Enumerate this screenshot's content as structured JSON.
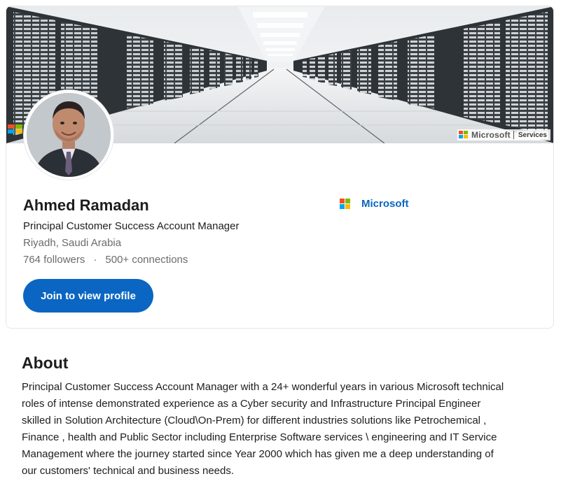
{
  "profile": {
    "name": "Ahmed Ramadan",
    "headline": "Principal Customer Success Account Manager",
    "location": "Riyadh, Saudi Arabia",
    "followers": "764 followers",
    "separator": "·",
    "connections": "500+ connections",
    "company": "Microsoft",
    "join_button": "Join to view profile"
  },
  "cover": {
    "brand_name": "Microsoft",
    "brand_sub": "Services"
  },
  "about": {
    "title": "About",
    "lines": [
      "Principal Customer Success Account Manager with a 24+ wonderful years in various Microsoft technical",
      "roles of intense demonstrated experience as a Cyber security and Infrastructure Principal Engineer",
      "skilled in Solution Architecture (Cloud\\On-Prem) for different industries solutions like Petrochemical ,",
      "Finance , health and Public Sector including Enterprise Software services \\ engineering and IT Service",
      "Management where the journey started since Year 2000 which has given me a deep understanding of",
      "our customers' technical and business needs."
    ]
  },
  "colors": {
    "accent": "#0a66c2",
    "ms_red": "#f25022",
    "ms_green": "#7fba00",
    "ms_blue": "#00a4ef",
    "ms_yellow": "#ffb900"
  },
  "icons": {
    "company_logo": "microsoft-logo-icon",
    "cover_logo": "microsoft-logo-icon"
  }
}
